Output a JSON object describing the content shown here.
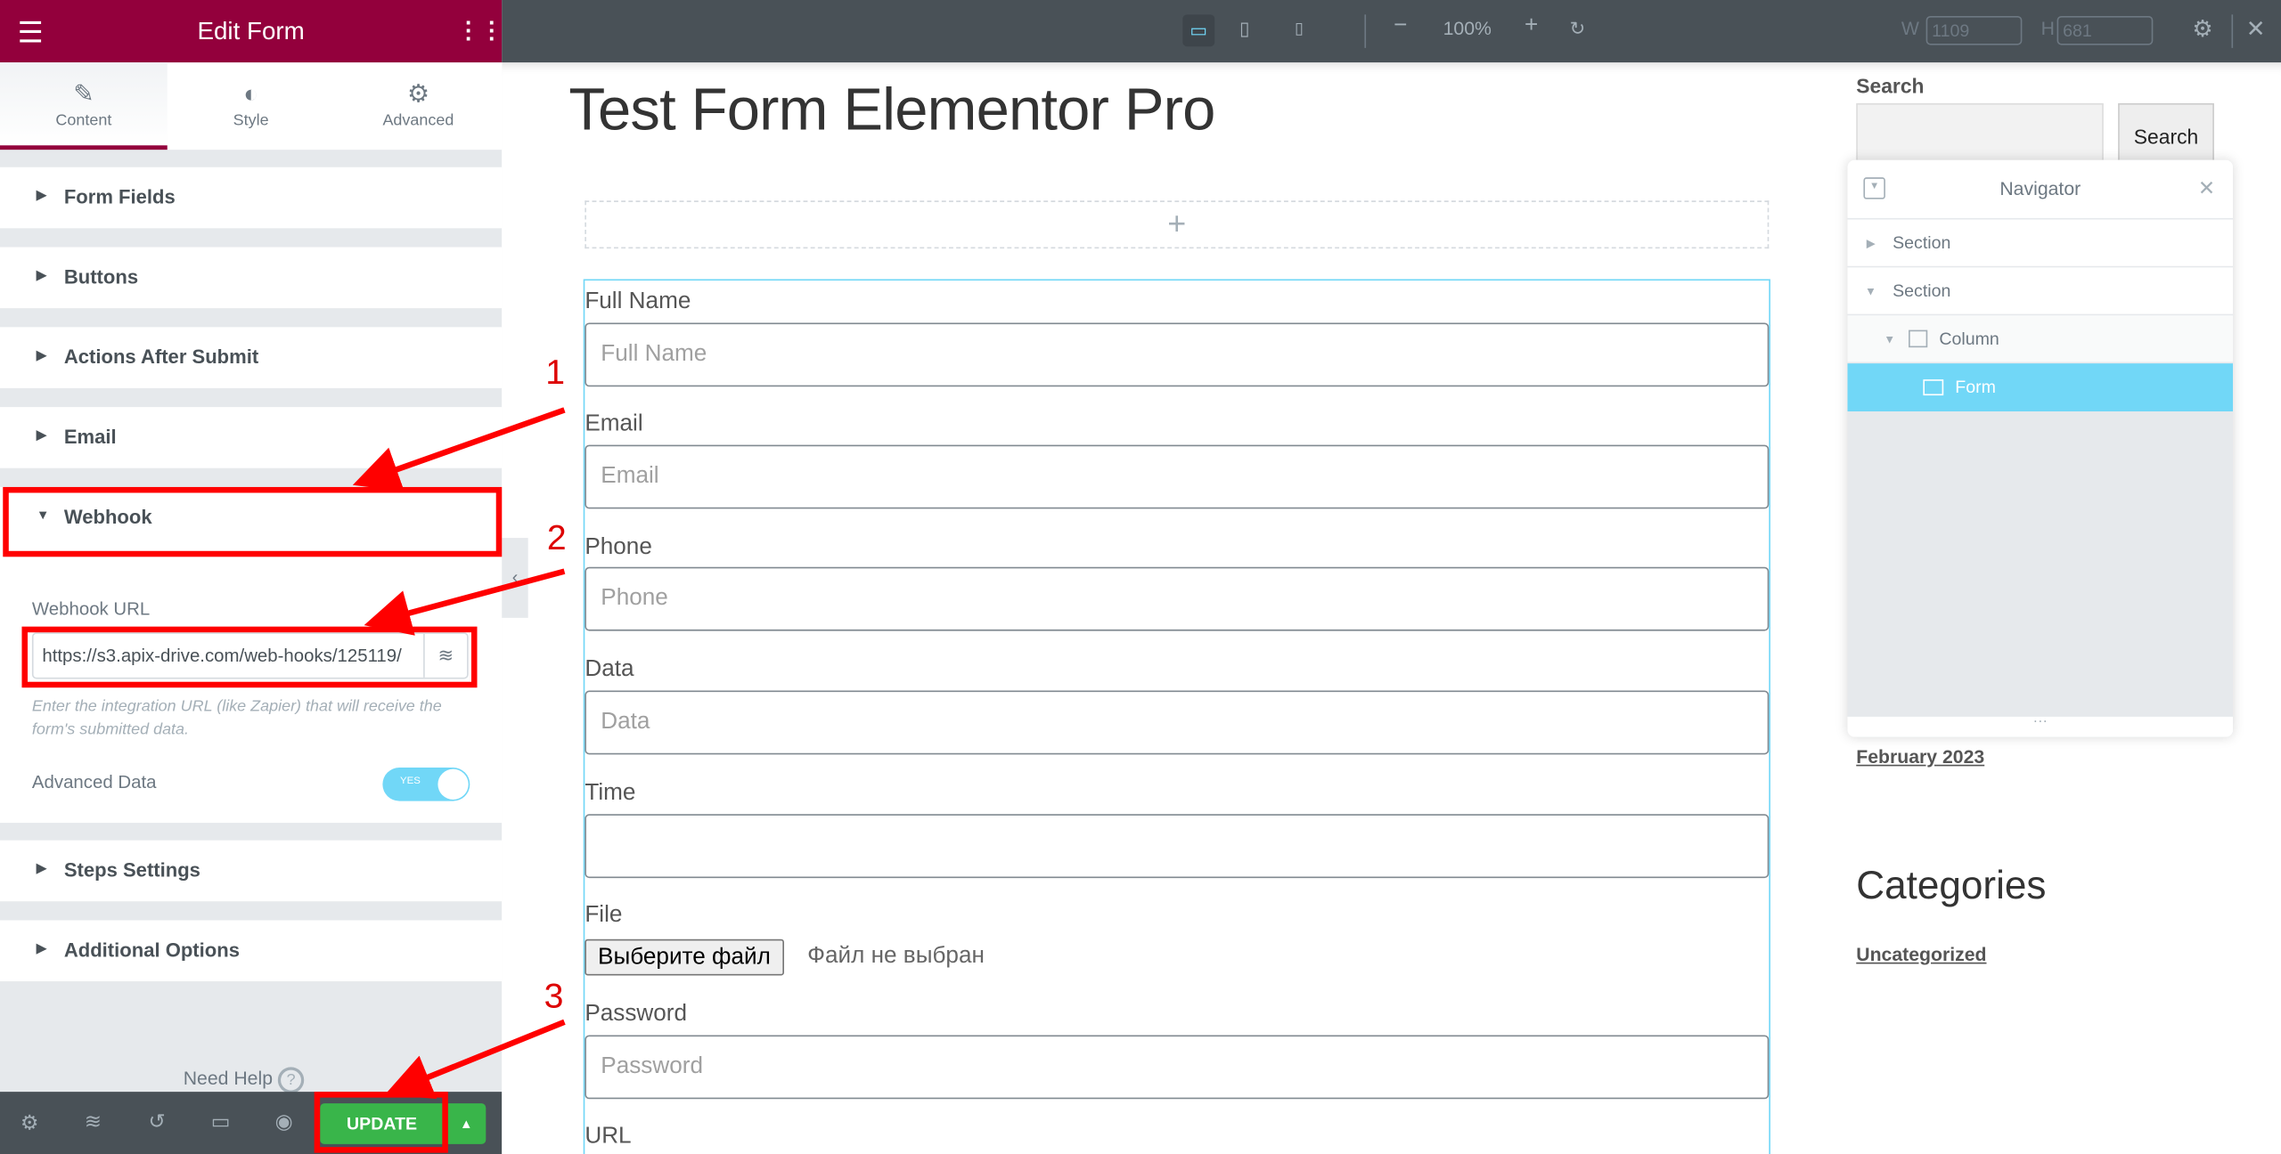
{
  "panel": {
    "title": "Edit Form",
    "tabs": [
      {
        "label": "Content",
        "icon": "pencil-icon"
      },
      {
        "label": "Style",
        "icon": "contrast-icon"
      },
      {
        "label": "Advanced",
        "icon": "gear-icon"
      }
    ],
    "sections": [
      "Form Fields",
      "Buttons",
      "Actions After Submit",
      "Email",
      "Webhook",
      "Steps Settings",
      "Additional Options"
    ],
    "webhook": {
      "url_label": "Webhook URL",
      "url_value": "https://s3.apix-drive.com/web-hooks/125119/",
      "help": "Enter the integration URL (like Zapier) that will receive the form's submitted data.",
      "advanced_label": "Advanced Data",
      "advanced_toggle": "YES"
    },
    "need_help": "Need Help",
    "update_label": "UPDATE",
    "accent": "#93003c",
    "update_color": "#39b54a"
  },
  "toolbar": {
    "zoom": "100%",
    "w_label": "W",
    "w_value": "1109",
    "h_label": "H",
    "h_value": "681"
  },
  "page": {
    "title": "Test Form Elementor Pro",
    "fields": [
      {
        "label": "Full Name",
        "placeholder": "Full Name"
      },
      {
        "label": "Email",
        "placeholder": "Email"
      },
      {
        "label": "Phone",
        "placeholder": "Phone"
      },
      {
        "label": "Data",
        "placeholder": "Data"
      },
      {
        "label": "Time",
        "placeholder": ""
      }
    ],
    "file": {
      "label": "File",
      "button": "Выберите файл",
      "status": "Файл не выбран"
    },
    "password": {
      "label": "Password",
      "placeholder": "Password"
    },
    "url_label": "URL"
  },
  "sidebar": {
    "search_heading": "Search",
    "search_button": "Search",
    "archive_link": "February 2023",
    "categories_heading": "Categories",
    "category_link": "Uncategorized"
  },
  "navigator": {
    "title": "Navigator",
    "items": [
      "Section",
      "Section",
      "Column",
      "Form"
    ]
  },
  "annotations": [
    "1",
    "2",
    "3"
  ]
}
